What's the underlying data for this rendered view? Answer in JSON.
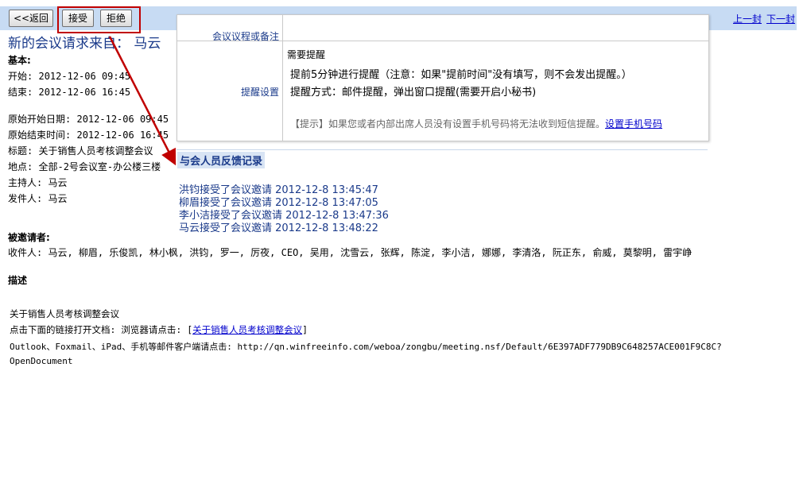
{
  "toolbar": {
    "back_label": "<<返回",
    "accept_label": "接受",
    "reject_label": "拒绝",
    "prev_label": "上一封",
    "next_label": "下一封"
  },
  "header": {
    "title": "新的会议请求来自：  马云"
  },
  "basic": {
    "heading": "基本:",
    "start_label": "开始:",
    "start_value": "2012-12-06 09:45",
    "end_label": "结束:",
    "end_value": "2012-12-06 16:45",
    "orig_start_label": "原始开始日期:",
    "orig_start_value": "2012-12-06 09:45",
    "orig_end_label": "原始结束时间:",
    "orig_end_value": "2012-12-06 16:45",
    "subject_label": "标题:",
    "subject_value": "关于销售人员考核调整会议",
    "location_label": "地点:",
    "location_value": "全部-2号会议室-办公楼三楼",
    "host_label": "主持人:",
    "host_value": "马云",
    "sender_label": "发件人:",
    "sender_value": "马云"
  },
  "invitees": {
    "heading": "被邀请者:",
    "recipients_label": "收件人:",
    "recipients_value": "马云, 柳眉, 乐俊凯, 林小枫, 洪钧, 罗一, 厉夜, CEO, 吴用, 沈雪云, 张辉, 陈淀, 李小洁, 娜娜, 李清洛, 阮正东, 俞威, 莫黎明, 雷宇峥"
  },
  "description": {
    "heading": "描述",
    "line1": "关于销售人员考核调整会议",
    "line2_prefix": "点击下面的链接打开文档:  浏览器请点击:  [",
    "line2_link": "关于销售人员考核调整会议",
    "line2_suffix": "]",
    "line3": "Outlook、Foxmail、iPad、手机等邮件客户端请点击:  http://qn.winfreeinfo.com/weboa/zongbu/meeting.nsf/Default/6E397ADF779DB9C648257ACE001F9C8C?",
    "line4": "OpenDocument"
  },
  "overlay": {
    "agenda_label": "会议议程或备注",
    "reminder_label": "提醒设置",
    "need_reminder": "需要提醒",
    "reminder_line1": "提前5分钟进行提醒（注意：如果\"提前时间\"没有填写，则不会发出提醒。）",
    "reminder_line2": "提醒方式：邮件提醒，弹出窗口提醒(需要开启小秘书)",
    "tip_text": "【提示】如果您或者内部出席人员没有设置手机号码将无法收到短信提醒。",
    "tip_link": "设置手机号码"
  },
  "feedback": {
    "title": "与会人员反馈记录",
    "records": [
      "洪钧接受了会议邀请 2012-12-8 13:45:47",
      "柳眉接受了会议邀请 2012-12-8 13:47:05",
      "李小洁接受了会议邀请 2012-12-8 13:47:36",
      "马云接受了会议邀请 2012-12-8 13:48:22"
    ]
  },
  "colors": {
    "highlight": "#c00000",
    "toolbar_bg": "#c7dbf3",
    "link": "#0000cc",
    "accent": "#1a3a8a"
  }
}
